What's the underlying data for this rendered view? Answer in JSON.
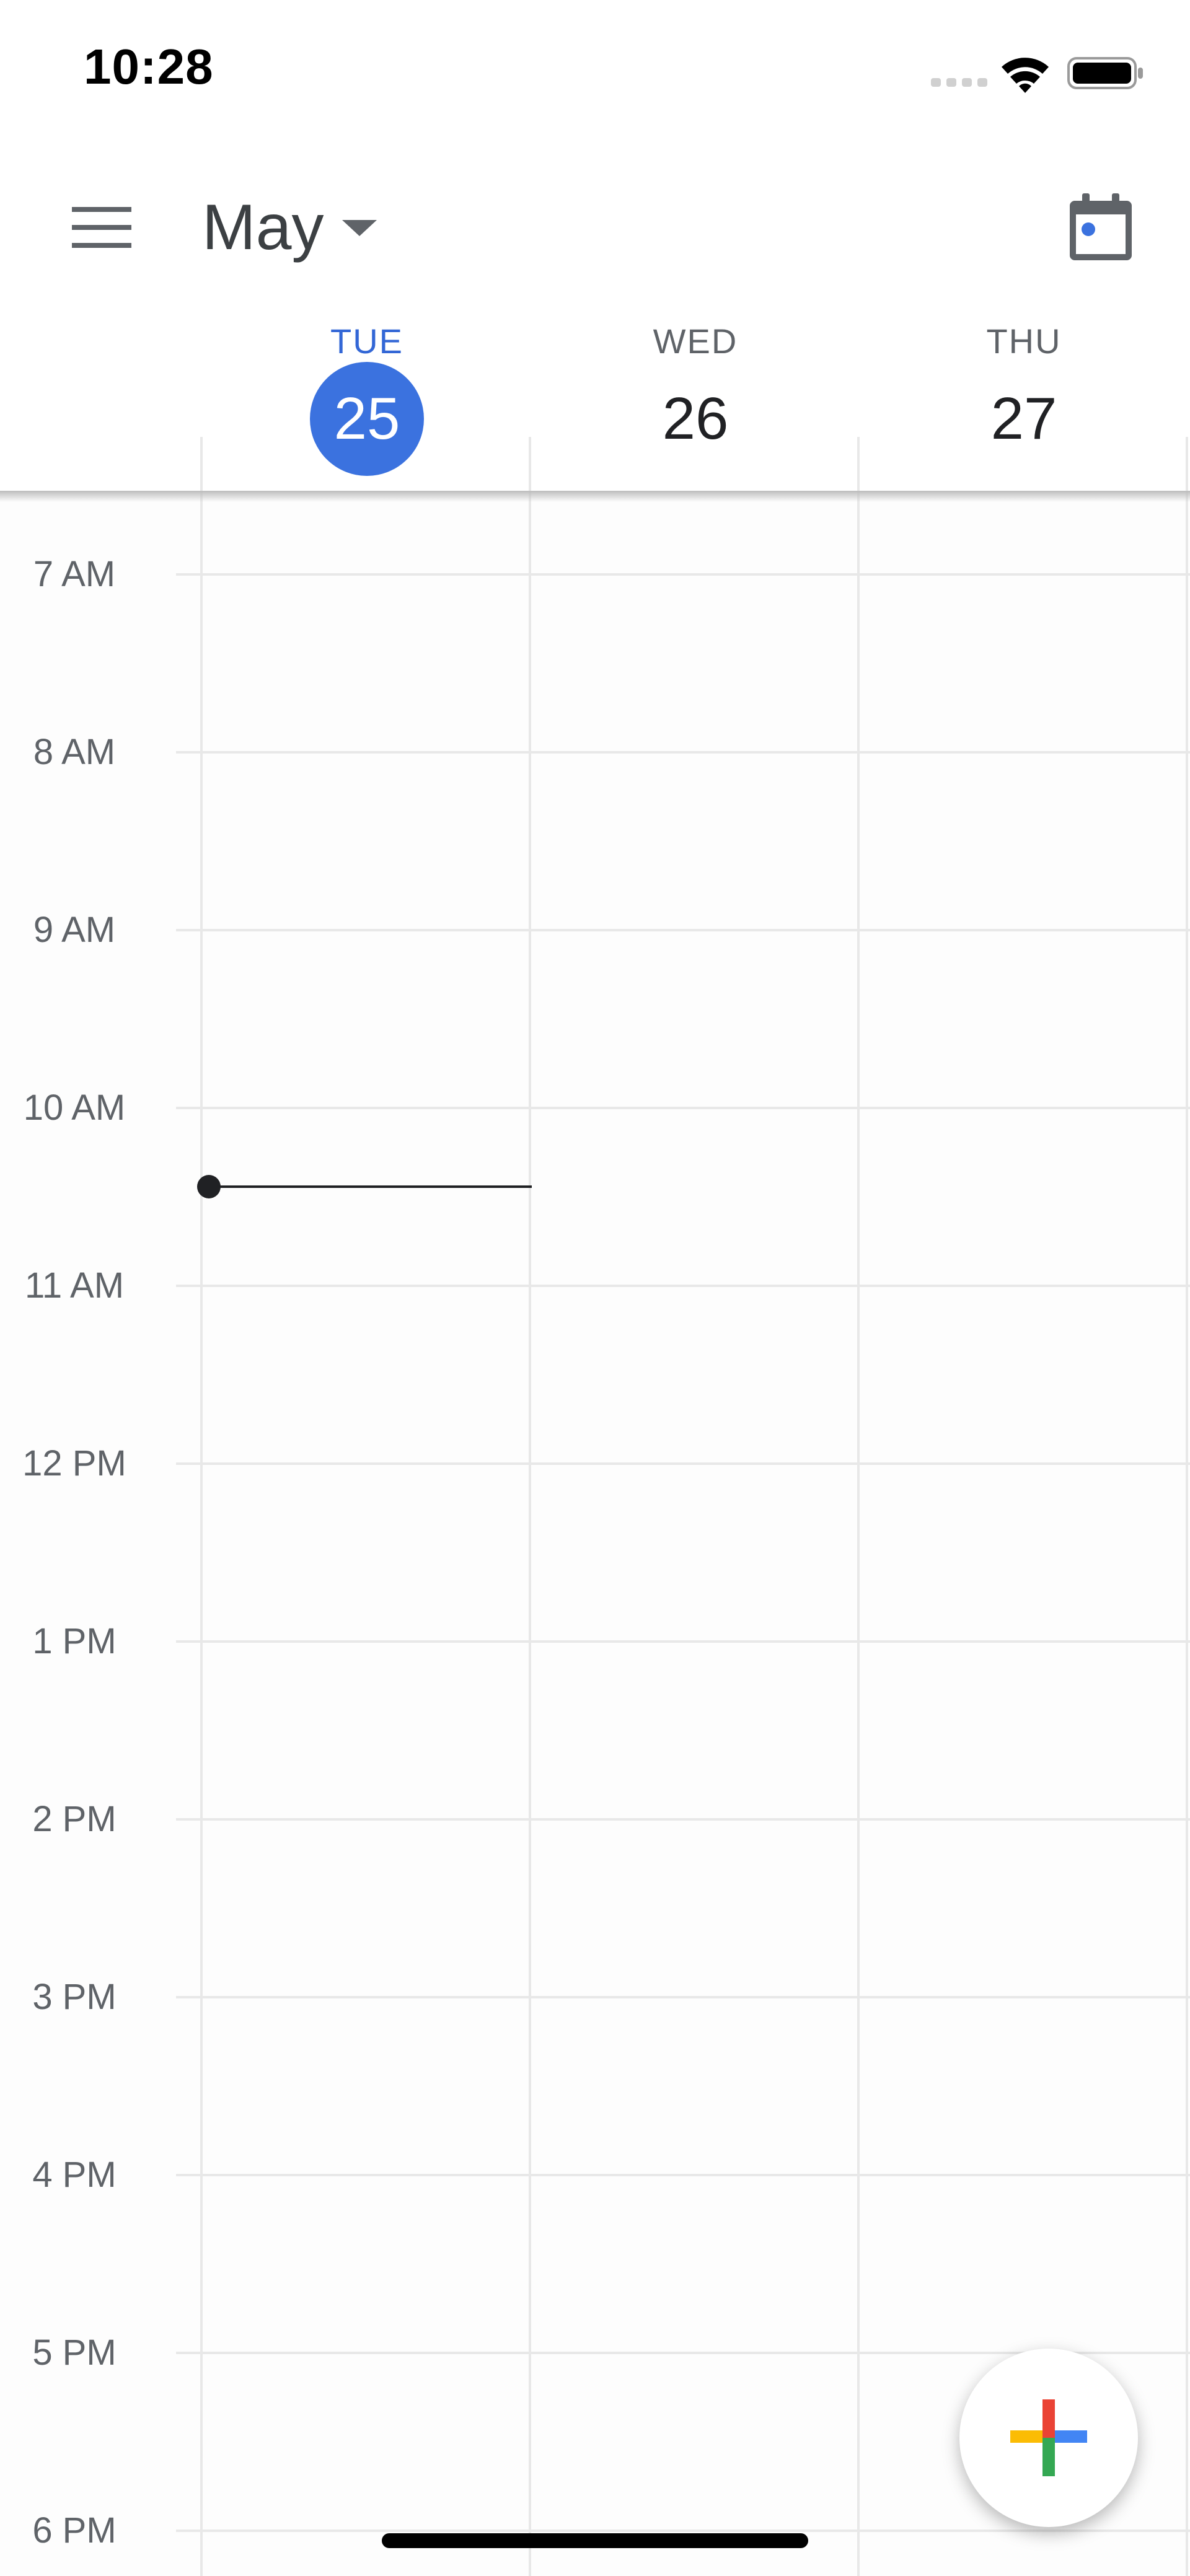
{
  "status_bar": {
    "time": "10:28",
    "icons": [
      "signal-icon",
      "wifi-icon",
      "battery-icon"
    ]
  },
  "app_bar": {
    "menu_icon": "menu-icon",
    "month": "May",
    "month_caret_icon": "chevron-down-icon",
    "today_icon": "calendar-today-icon"
  },
  "days": [
    {
      "dow": "TUE",
      "num": "25",
      "is_today": true
    },
    {
      "dow": "WED",
      "num": "26",
      "is_today": false
    },
    {
      "dow": "THU",
      "num": "27",
      "is_today": false
    }
  ],
  "hours": [
    "7 AM",
    "8 AM",
    "9 AM",
    "10 AM",
    "11 AM",
    "12 PM",
    "1 PM",
    "2 PM",
    "3 PM",
    "4 PM",
    "5 PM",
    "6 PM"
  ],
  "current_time_indicator": {
    "time": "10:28",
    "day_index": 0
  },
  "fab": {
    "icon": "add-icon"
  },
  "colors": {
    "accent": "#3b72df",
    "today_label": "#3367d6",
    "grid_line": "#e8e8e8",
    "plus_red": "#ea4335",
    "plus_blue": "#4285f4",
    "plus_green": "#34a853",
    "plus_yellow": "#fbbc04"
  }
}
